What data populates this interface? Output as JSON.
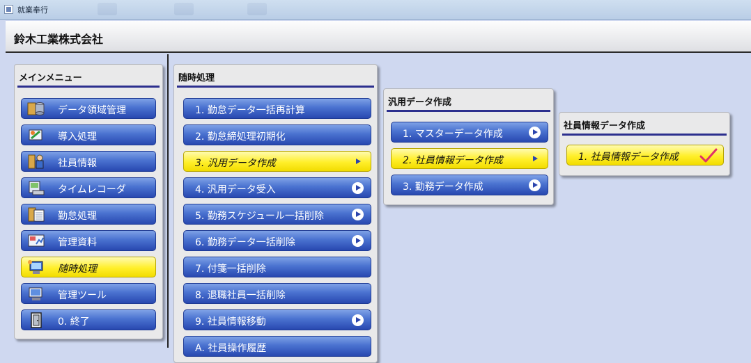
{
  "window": {
    "title": "就業奉行"
  },
  "company": {
    "name": "鈴木工業株式会社"
  },
  "main_menu": {
    "title": "メインメニュー",
    "items": [
      {
        "label": "データ領域管理",
        "icon": "database-icon",
        "selected": false
      },
      {
        "label": "導入処理",
        "icon": "setup-icon",
        "selected": false
      },
      {
        "label": "社員情報",
        "icon": "employee-icon",
        "selected": false
      },
      {
        "label": "タイムレコーダ",
        "icon": "time-recorder-icon",
        "selected": false
      },
      {
        "label": "勤怠処理",
        "icon": "attendance-icon",
        "selected": false
      },
      {
        "label": "管理資料",
        "icon": "report-icon",
        "selected": false
      },
      {
        "label": "随時処理",
        "icon": "adhoc-process-icon",
        "selected": true
      },
      {
        "label": "管理ツール",
        "icon": "admin-tool-icon",
        "selected": false
      },
      {
        "label": "0. 終了",
        "icon": "exit-door-icon",
        "selected": false
      }
    ]
  },
  "adhoc_menu": {
    "title": "随時処理",
    "items": [
      {
        "label": "1. 勤怠データ一括再計算",
        "arrow": false,
        "selected": false
      },
      {
        "label": "2. 勤怠締処理初期化",
        "arrow": false,
        "selected": false
      },
      {
        "label": "3. 汎用データ作成",
        "arrow": true,
        "selected": true
      },
      {
        "label": "4. 汎用データ受入",
        "arrow": true,
        "selected": false
      },
      {
        "label": "5. 勤務スケジュール一括削除",
        "arrow": true,
        "selected": false
      },
      {
        "label": "6. 勤務データ一括削除",
        "arrow": true,
        "selected": false
      },
      {
        "label": "7. 付箋一括削除",
        "arrow": false,
        "selected": false
      },
      {
        "label": "8. 退職社員一括削除",
        "arrow": false,
        "selected": false
      },
      {
        "label": "9. 社員情報移動",
        "arrow": true,
        "selected": false
      },
      {
        "label": "A. 社員操作履歴",
        "arrow": false,
        "selected": false
      }
    ]
  },
  "generic_data_menu": {
    "title": "汎用データ作成",
    "items": [
      {
        "label": "1. マスターデータ作成",
        "arrow": true,
        "selected": false
      },
      {
        "label": "2. 社員情報データ作成",
        "arrow": true,
        "selected": true
      },
      {
        "label": "3. 勤務データ作成",
        "arrow": true,
        "selected": false
      }
    ]
  },
  "employee_data_menu": {
    "title": "社員情報データ作成",
    "items": [
      {
        "label": "1. 社員情報データ作成",
        "icon": "checkmark-icon",
        "selected": true
      }
    ]
  },
  "colors": {
    "button_blue": "#3a5cc4",
    "button_selected_yellow": "#ffef2a",
    "panel_bg": "#e9e9ea",
    "desktop_bg": "#cfd8f0",
    "title_underline": "#2c2f8e",
    "check_mark": "#e0306a"
  }
}
